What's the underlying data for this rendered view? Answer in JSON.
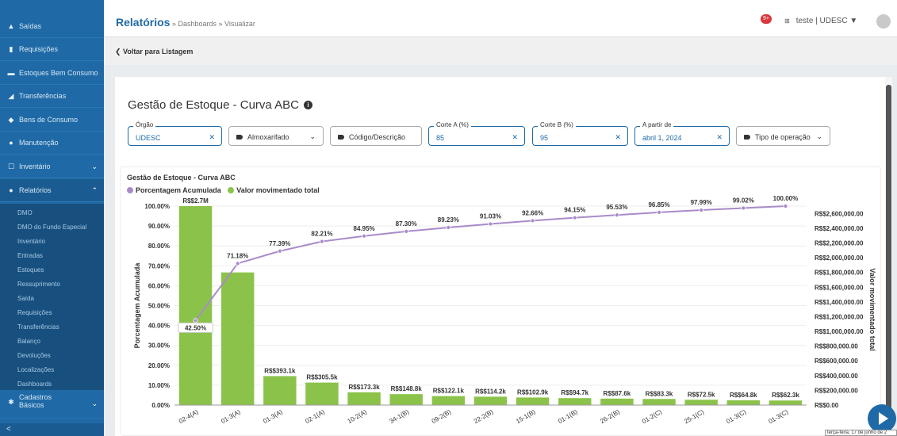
{
  "sidebar": {
    "items": [
      {
        "label": "Saídas",
        "icon": "up-arrow-icon"
      },
      {
        "label": "Requisições",
        "icon": "file-icon"
      },
      {
        "label": "Estoques Bem Consumo",
        "icon": "stack-icon"
      },
      {
        "label": "Transferências",
        "icon": "send-icon"
      },
      {
        "label": "Bens de Consumo",
        "icon": "tag-icon"
      },
      {
        "label": "Manutenção",
        "icon": "car-icon"
      },
      {
        "label": "Inventário",
        "icon": "clipboard-icon"
      },
      {
        "label": "Relatórios",
        "icon": "chart-icon"
      }
    ],
    "submenu": [
      "DMO",
      "DMO do Fundo Especial",
      "Inventário",
      "Entradas",
      "Estoques",
      "Ressuprimento",
      "Saída",
      "Requisições",
      "Transferências",
      "Balanço",
      "Devoluções",
      "Localizações",
      "Dashboards"
    ],
    "cadastros": [
      "Cadastros",
      "Básicos"
    ],
    "bottom_icon": "<"
  },
  "header": {
    "title": "Relatórios",
    "breadcrumb": " » Dashboards » Visualizar",
    "badge": "9+",
    "user": "teste | UDESC ▼"
  },
  "backbar": {
    "label": "Voltar para Listagem"
  },
  "page": {
    "title": "Gestão de Estoque - Curva ABC"
  },
  "filters": {
    "orgao": {
      "label": "Órgão",
      "value": "UDESC"
    },
    "almoxarifado": "Almoxarifado",
    "codigo": "Código/Descrição",
    "corte_a": {
      "label": "Corte A (%)",
      "value": "85"
    },
    "corte_b": {
      "label": "Corte B (%)",
      "value": "95"
    },
    "a_partir": {
      "label": "A partir de",
      "value": "abril 1, 2024"
    },
    "tipo": "Tipo de operação"
  },
  "chart_panel": {
    "title": "Gestão de Estoque - Curva ABC"
  },
  "tooltip_date": "terça-feira, 17 de junho de 2",
  "chart_data": {
    "type": "bar",
    "series": [
      {
        "name": "Porcentagem Acumulada",
        "type": "line",
        "color": "#a98bc9",
        "values": [
          42.5,
          71.18,
          77.39,
          82.21,
          84.95,
          87.3,
          89.23,
          91.03,
          92.66,
          94.15,
          95.53,
          96.85,
          97.99,
          99.02,
          100.0
        ],
        "labels": [
          "42.50%",
          "71.18%",
          "77.39%",
          "82.21%",
          "84.95%",
          "87.30%",
          "89.23%",
          "91.03%",
          "92.66%",
          "94.15%",
          "95.53%",
          "96.85%",
          "97.99%",
          "99.02%",
          "100.00%"
        ]
      },
      {
        "name": "Valor movimentado total",
        "type": "bar",
        "color": "#8bc34a",
        "values": [
          2700000,
          1800000,
          393100,
          305500,
          173300,
          148800,
          122100,
          114200,
          102900,
          94700,
          87600,
          83300,
          72500,
          64800,
          62300
        ],
        "labels": [
          "R$$2.7M",
          "",
          "R$$393.1k",
          "R$$305.5k",
          "R$$173.3k",
          "R$$148.8k",
          "R$$122.1k",
          "R$$114.2k",
          "R$$102.9k",
          "R$$94.7k",
          "R$$87.6k",
          "R$$83.3k",
          "R$$72.5k",
          "R$$64.8k",
          "R$$62.3k"
        ]
      }
    ],
    "categories": [
      "02-4(A)",
      "01-3(A)",
      "01-3(A)",
      "02-1(A)",
      "10-2(A)",
      "34-1(B)",
      "09-2(B)",
      "22-2(B)",
      "15-1(B)",
      "01-1(B)",
      "26-2(B)",
      "01-2(C)",
      "25-1(C)",
      "01-3(C)",
      "01-3(C)"
    ],
    "ylabel_left": "Porcentagem Acumulada",
    "ylabel_right": "Valor movimentado total",
    "left_ticks": [
      "0.00%",
      "10.00%",
      "20.00%",
      "30.00%",
      "40.00%",
      "50.00%",
      "60.00%",
      "70.00%",
      "80.00%",
      "90.00%",
      "100.00%"
    ],
    "right_ticks": [
      "R$$0.00",
      "R$$200,000.00",
      "R$$400,000.00",
      "R$$600,000.00",
      "R$$800,000.00",
      "R$$1,000,000.00",
      "R$$1,200,000.00",
      "R$$1,400,000.00",
      "R$$1,600,000.00",
      "R$$1,800,000.00",
      "R$$2,000,000.00",
      "R$$2,200,000.00",
      "R$$2,400,000.00",
      "R$$2,600,000.00"
    ],
    "ylim_left": [
      0,
      100
    ],
    "ylim_right": [
      0,
      2700000
    ],
    "legend": "top-left",
    "grid": true
  }
}
